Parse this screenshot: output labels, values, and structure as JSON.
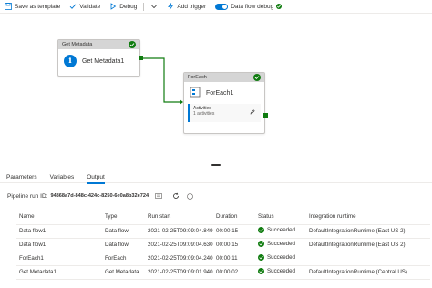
{
  "toolbar": {
    "save_template": "Save as template",
    "validate": "Validate",
    "debug": "Debug",
    "add_trigger": "Add trigger",
    "data_flow_debug": "Data flow debug"
  },
  "canvas": {
    "get_metadata": {
      "header": "Get Metadata",
      "name": "Get Metadata1"
    },
    "foreach": {
      "header": "ForEach",
      "name": "ForEach1",
      "activities_label": "Activities",
      "activities_count": "1 activities"
    }
  },
  "tabs": [
    "Parameters",
    "Variables",
    "Output"
  ],
  "run": {
    "label": "Pipeline run ID:",
    "id": "94868a7d-848c-424c-8250-6e0a8b32e724"
  },
  "table": {
    "columns": [
      "Name",
      "Type",
      "Run start",
      "Duration",
      "Status",
      "Integration runtime"
    ],
    "rows": [
      [
        "Data flow1",
        "Data flow",
        "2021-02-25T09:09:04.849",
        "00:00:15",
        "Succeeded",
        "DefaultIntegrationRuntime (East US 2)"
      ],
      [
        "Data flow1",
        "Data flow",
        "2021-02-25T09:09:04.630",
        "00:00:15",
        "Succeeded",
        "DefaultIntegrationRuntime (East US 2)"
      ],
      [
        "ForEach1",
        "ForEach",
        "2021-02-25T09:09:04.240",
        "00:00:11",
        "Succeeded",
        ""
      ],
      [
        "Get Metadata1",
        "Get Metadata",
        "2021-02-25T09:09:01.940",
        "00:00:02",
        "Succeeded",
        "DefaultIntegrationRuntime (Central US)"
      ]
    ]
  },
  "colors": {
    "accent": "#0078d4",
    "success": "#107c10"
  }
}
